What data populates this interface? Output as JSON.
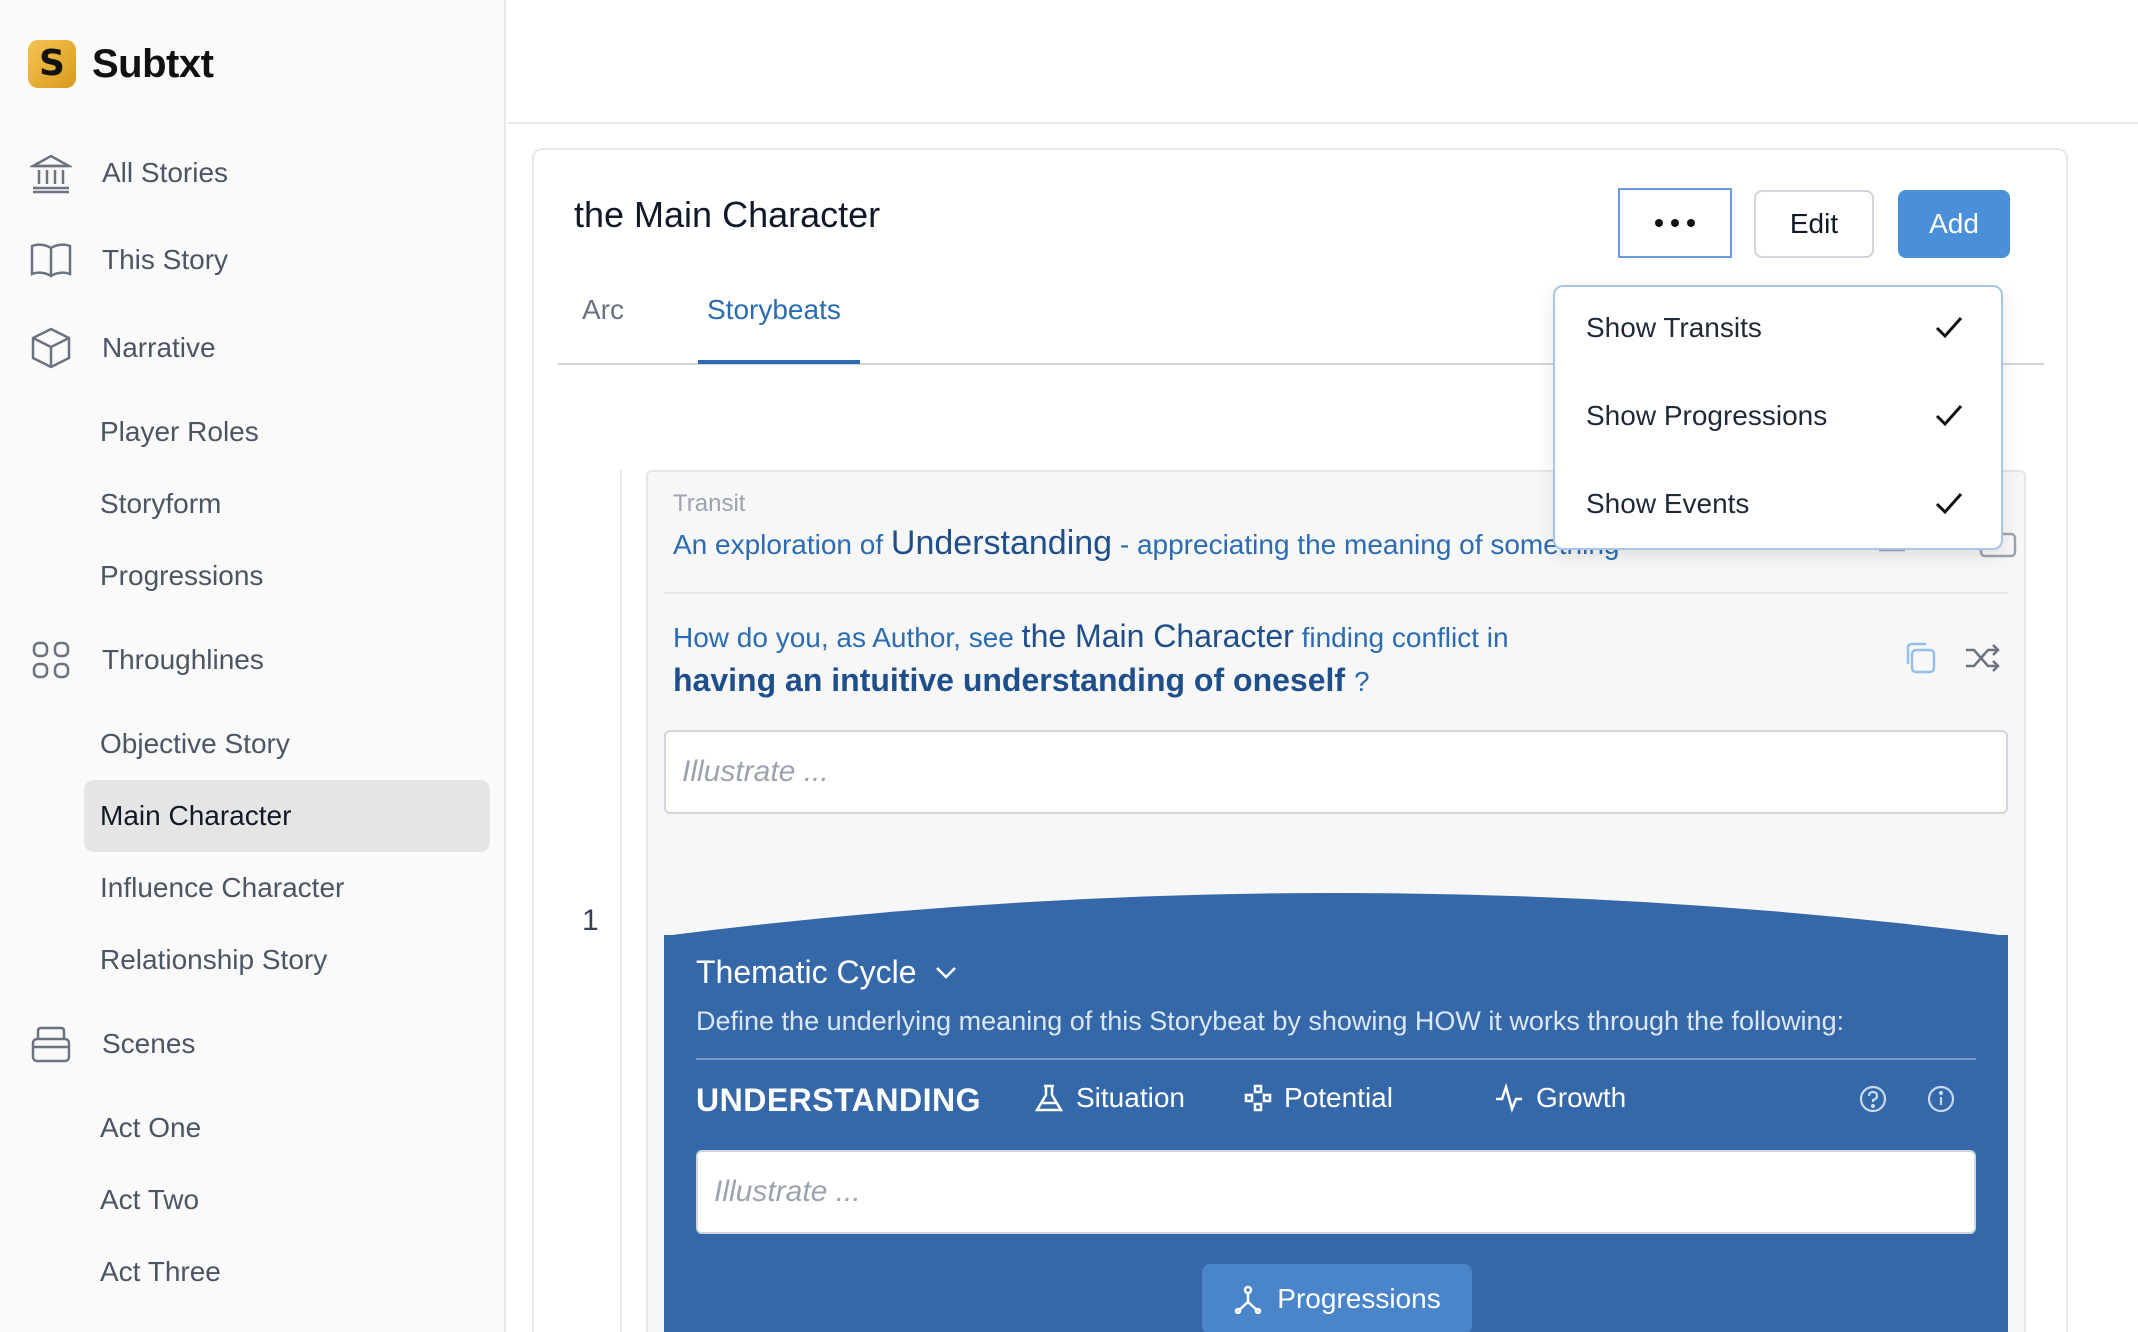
{
  "app": {
    "name": "Subtxt",
    "logo_letter": "S"
  },
  "sidebar": {
    "all_stories": "All Stories",
    "this_story": "This Story",
    "narrative": "Narrative",
    "narrative_items": [
      "Player Roles",
      "Storyform",
      "Progressions"
    ],
    "throughlines": "Throughlines",
    "throughline_items": [
      "Objective Story",
      "Main Character",
      "Influence Character",
      "Relationship Story"
    ],
    "active_item": "Main Character",
    "scenes": "Scenes",
    "scene_items": [
      "Act One",
      "Act Two",
      "Act Three"
    ]
  },
  "card": {
    "title": "the Main Character",
    "edit_label": "Edit",
    "add_label": "Add",
    "tabs": [
      "Arc",
      "Storybeats"
    ],
    "active_tab": "Storybeats"
  },
  "menu": {
    "items": [
      "Show Transits",
      "Show Progressions",
      "Show Events"
    ]
  },
  "beat": {
    "number": "1",
    "transit_label": "Transit",
    "transit_prefix": "An exploration of",
    "transit_concept": "Understanding",
    "transit_suffix": "- appreciating the meaning of something",
    "question_prefix": "How do you, as Author, see",
    "question_subject": "the Main Character",
    "question_mid": "finding conflict in",
    "question_focus": "having an intuitive understanding of oneself",
    "question_mark": "?",
    "illustrate_placeholder": "Illustrate ..."
  },
  "cycle": {
    "title": "Thematic Cycle",
    "description": "Define the underlying meaning of this Storybeat by showing HOW it works through the following:",
    "concept": "UNDERSTANDING",
    "situation": "Situation",
    "potential": "Potential",
    "growth": "Growth",
    "illustrate_placeholder": "Illustrate ...",
    "progressions_label": "Progressions"
  },
  "colors": {
    "accent": "#4a90d9",
    "cycle_bg": "#3568a8",
    "link": "#2b6cb0"
  }
}
